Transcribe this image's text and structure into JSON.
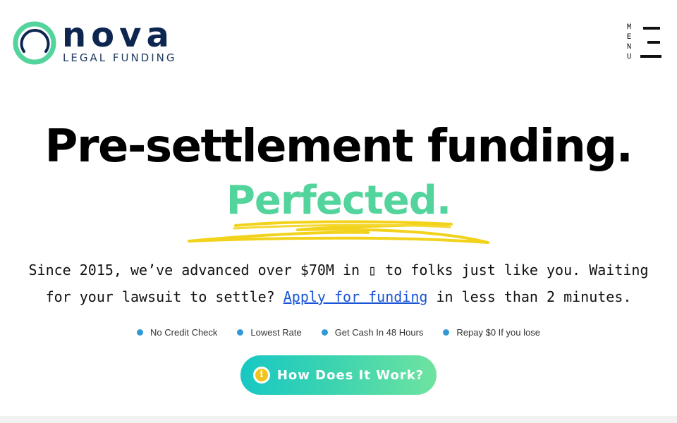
{
  "brand": {
    "name": "nova",
    "subtitle": "LEGAL FUNDING",
    "ring_color_outer": "#52d49c",
    "ring_color_inner": "#0d2650"
  },
  "menu": {
    "letters": [
      "M",
      "E",
      "N",
      "U"
    ]
  },
  "hero": {
    "title": "Pre-settlement funding.",
    "accent": "Perfected.",
    "accent_color": "#52d49c",
    "tagline_part1": "Since 2015, we’ve advanced over $70M in ",
    "tagline_emoji": "▯",
    "tagline_part2": " to folks just like you. Waiting for your lawsuit to settle? ",
    "apply_link": "Apply for funding",
    "tagline_part3": " in less than 2 minutes."
  },
  "features": [
    "No Credit Check",
    "Lowest Rate",
    "Get Cash In 48 Hours",
    "Repay $0 If you lose"
  ],
  "cta": {
    "label": "How Does It Work?",
    "icon": "info-icon"
  }
}
